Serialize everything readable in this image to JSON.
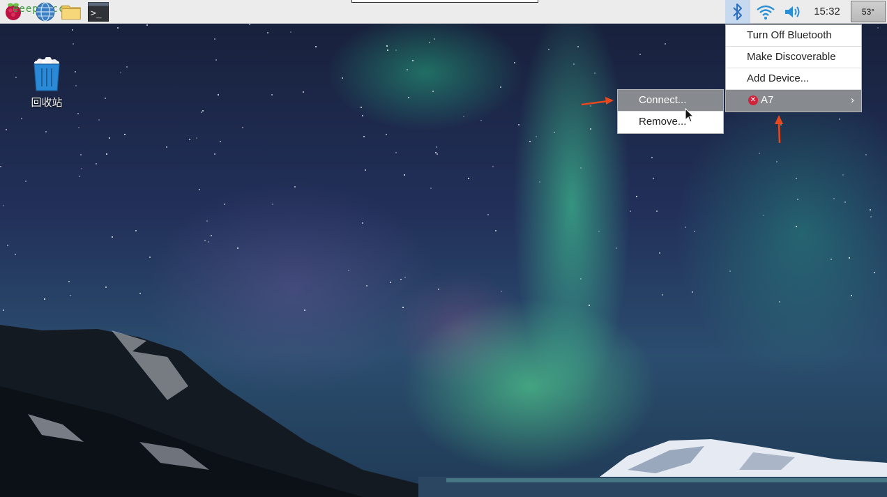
{
  "taskbar": {
    "launchers": [
      {
        "name": "raspberry-menu"
      },
      {
        "name": "web-browser"
      },
      {
        "name": "file-manager"
      },
      {
        "name": "terminal"
      }
    ],
    "watermark": "eeepi.cc",
    "clock": "15:32",
    "cpu_temp": "53°"
  },
  "desktop": {
    "trash_label": "回收站"
  },
  "bluetooth_menu": {
    "items": [
      {
        "label": "Turn Off Bluetooth"
      },
      {
        "label": "Make Discoverable"
      },
      {
        "label": "Add Device..."
      },
      {
        "label": "A7",
        "status": "disconnected",
        "has_submenu": true
      }
    ]
  },
  "device_menu": {
    "items": [
      {
        "label": "Connect...",
        "highlighted": true
      },
      {
        "label": "Remove..."
      }
    ]
  },
  "colors": {
    "annotation_arrow": "#e8481e",
    "menu_highlight": "#878b8f",
    "status_error": "#d0243d"
  }
}
